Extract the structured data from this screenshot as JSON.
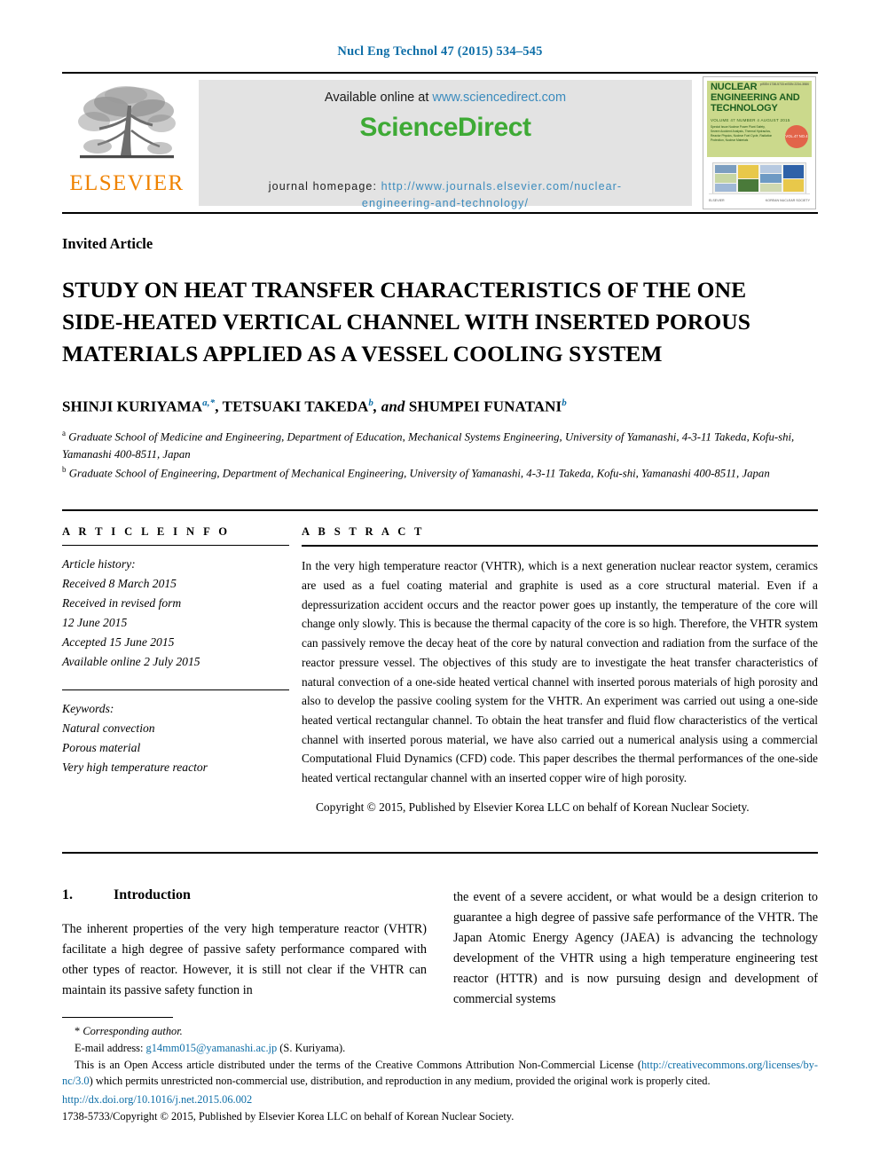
{
  "running_head": "Nucl Eng Technol 47 (2015) 534–545",
  "masthead": {
    "publisher_logo_text": "ELSEVIER",
    "publisher_logo_icon": "elsevier-tree-logo",
    "available_prefix": "Available online at ",
    "available_url": "www.sciencedirect.com",
    "sciencedirect_logo_text": "ScienceDirect",
    "homepage_label": "journal homepage: ",
    "homepage_url_line1": "http://www.journals.elsevier.com/nuclear-",
    "homepage_url_line2": "engineering-and-technology/",
    "cover": {
      "title_line1": "NUCLEAR",
      "title_line2": "ENGINEERING AND",
      "title_line3": "TECHNOLOGY",
      "volume_line": "VOLUME 47 NUMBER 4 AUGUST 2015",
      "issn_line": "pISSN 1738-5733\neISSN 2234-358X",
      "badge_text": "VOL.47 NO.4",
      "abstract_block": "Special Issue\nNuclear Power Plant Safety, Severe Accident Analysis,\nThermal Hydraulics, Reactor Physics, Nuclear Fuel Cycle,\nRadiation Protection, Nuclear Materials",
      "footer_left": "ELSEVIER",
      "footer_right": "KOREAN NUCLEAR SOCIETY"
    }
  },
  "front": {
    "article_type": "Invited Article",
    "title_line1": "STUDY ON HEAT TRANSFER CHARACTERISTICS OF THE ONE",
    "title_line2": "SIDE-HEATED VERTICAL CHANNEL WITH INSERTED POROUS",
    "title_line3": "MATERIALS APPLIED AS A VESSEL COOLING SYSTEM",
    "authors": {
      "a1_name": "SHINJI KURIYAMA",
      "a1_marks": "a,*",
      "a2_name": "TETSUAKI TAKEDA",
      "a2_marks": "b",
      "conjunction": ", and ",
      "a3_name": "SHUMPEI FUNATANI",
      "a3_marks": "b",
      "separator": ", "
    },
    "affiliations": [
      {
        "mark": "a",
        "text": "Graduate School of Medicine and Engineering, Department of Education, Mechanical Systems Engineering, University of Yamanashi, 4-3-11 Takeda, Kofu-shi, Yamanashi 400-8511, Japan"
      },
      {
        "mark": "b",
        "text": "Graduate School of Engineering, Department of Mechanical Engineering, University of Yamanashi, 4-3-11 Takeda, Kofu-shi, Yamanashi 400-8511, Japan"
      }
    ]
  },
  "article_info": {
    "heading": "A R T I C L E   I N F O",
    "history_label": "Article history:",
    "history": [
      "Received 8 March 2015",
      "Received in revised form",
      "12 June 2015",
      "Accepted 15 June 2015",
      "Available online 2 July 2015"
    ],
    "keywords_label": "Keywords:",
    "keywords": [
      "Natural convection",
      "Porous material",
      "Very high temperature reactor"
    ]
  },
  "abstract": {
    "heading": "A B S T R A C T",
    "body": "In the very high temperature reactor (VHTR), which is a next generation nuclear reactor system, ceramics are used as a fuel coating material and graphite is used as a core structural material. Even if a depressurization accident occurs and the reactor power goes up instantly, the temperature of the core will change only slowly. This is because the thermal capacity of the core is so high. Therefore, the VHTR system can passively remove the decay heat of the core by natural convection and radiation from the surface of the reactor pressure vessel. The objectives of this study are to investigate the heat transfer characteristics of natural convection of a one-side heated vertical channel with inserted porous materials of high porosity and also to develop the passive cooling system for the VHTR. An experiment was carried out using a one-side heated vertical rectangular channel. To obtain the heat transfer and fluid flow characteristics of the vertical channel with inserted porous material, we have also carried out a numerical analysis using a commercial Computational Fluid Dynamics (CFD) code. This paper describes the thermal performances of the one-side heated vertical rectangular channel with an inserted copper wire of high porosity.",
    "copyright": "Copyright © 2015, Published by Elsevier Korea LLC on behalf of Korean Nuclear Society."
  },
  "body": {
    "section_number": "1.",
    "section_title": "Introduction",
    "left_paragraph": "The inherent properties of the very high temperature reactor (VHTR) facilitate a high degree of passive safety performance compared with other types of reactor. However, it is still not clear if the VHTR can maintain its passive safety function in",
    "right_paragraph": "the event of a severe accident, or what would be a design criterion to guarantee a high degree of passive safe performance of the VHTR. The Japan Atomic Energy Agency (JAEA) is advancing the technology development of the VHTR using a high temperature engineering test reactor (HTTR) and is now pursuing design and development of commercial systems"
  },
  "footnotes": {
    "corresponding_star": "*",
    "corresponding_text": "Corresponding author.",
    "email_label": "E-mail address: ",
    "email_value": "g14mm015@yamanashi.ac.jp",
    "email_suffix": " (S. Kuriyama).",
    "open_access_pre": "This is an Open Access article distributed under the terms of the Creative Commons Attribution Non-Commercial License (",
    "open_access_link": "http://creativecommons.org/licenses/by-nc/3.0",
    "open_access_post": ") which permits unrestricted non-commercial use, distribution, and reproduction in any medium, provided the original work is properly cited.",
    "doi": "http://dx.doi.org/10.1016/j.net.2015.06.002",
    "issn_copyright": "1738-5733/Copyright © 2015, Published by Elsevier Korea LLC on behalf of Korean Nuclear Society."
  },
  "colors": {
    "link_blue": "#0f6fa8",
    "sciencedirect_green": "#3eaa35",
    "elsevier_orange": "#ef8200",
    "cover_green": "#cbd98c",
    "masthead_grey": "#e3e3e3"
  }
}
